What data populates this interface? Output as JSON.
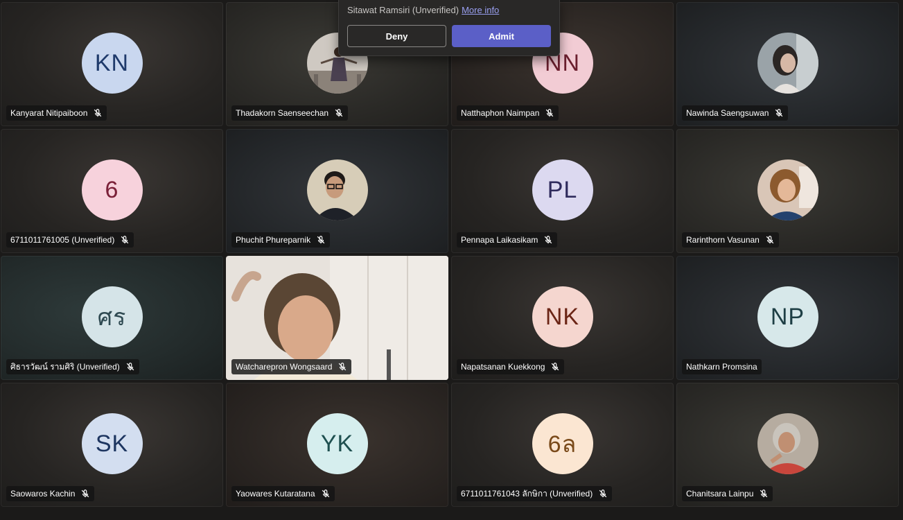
{
  "lobby_notification": {
    "message": "Sitawat Ramsiri (Unverified)",
    "more_info_link": "More info",
    "deny_label": "Deny",
    "admit_label": "Admit"
  },
  "participants": [
    {
      "name": "Kanyarat Nitipaiboon",
      "initials": "KN",
      "avatar_bg": "#c9d7ef",
      "avatar_fg": "#1f3a6b",
      "muted": true
    },
    {
      "name": "Thadakorn Saenseechan",
      "photo": "dancer-photo",
      "muted": true
    },
    {
      "name": "Natthaphon Naimpan",
      "initials": "NN",
      "avatar_bg": "#f2ccd4",
      "avatar_fg": "#6b1f2e",
      "muted": true
    },
    {
      "name": "Nawinda Saengsuwan",
      "photo": "portrait-photo",
      "muted": true
    },
    {
      "name": "6711011761005 (Unverified)",
      "initials": "6",
      "avatar_bg": "#f7d2dc",
      "avatar_fg": "#7a2038",
      "muted": true
    },
    {
      "name": "Phuchit Phureparnik",
      "photo": "portrait-glasses-photo",
      "muted": true
    },
    {
      "name": "Pennapa Laikasikam",
      "initials": "PL",
      "avatar_bg": "#dcd9f0",
      "avatar_fg": "#2e2a5c",
      "muted": true
    },
    {
      "name": "Rarinthorn Vasunan",
      "photo": "selfie-photo",
      "muted": true
    },
    {
      "name": "ศิธารวัฒน์ รามศิริ (Unverified)",
      "initials": "ศร",
      "avatar_bg": "#d5e4e8",
      "avatar_fg": "#2f4a52",
      "muted": true
    },
    {
      "name": "Watcharepron Wongsaard",
      "video": true,
      "muted": true
    },
    {
      "name": "Napatsanan Kuekkong",
      "initials": "NK",
      "avatar_bg": "#f5d6cf",
      "avatar_fg": "#6b2516",
      "muted": true
    },
    {
      "name": "Nathkarn Promsina",
      "initials": "NP",
      "avatar_bg": "#d7e8ea",
      "avatar_fg": "#1e3f45",
      "muted": false
    },
    {
      "name": "Saowaros Kachin",
      "initials": "SK",
      "avatar_bg": "#d3def0",
      "avatar_fg": "#1d3560",
      "muted": true
    },
    {
      "name": "Yaowares Kutaratana",
      "initials": "YK",
      "avatar_bg": "#d6eeee",
      "avatar_fg": "#1f5050",
      "muted": true
    },
    {
      "name": "6711011761043 ลักษิกา (Unverified)",
      "initials": "6ล",
      "avatar_bg": "#fbe6d2",
      "avatar_fg": "#7a4a1a",
      "muted": true
    },
    {
      "name": "Chanitsara Lainpu",
      "photo": "portrait-older-photo",
      "muted": true
    }
  ]
}
